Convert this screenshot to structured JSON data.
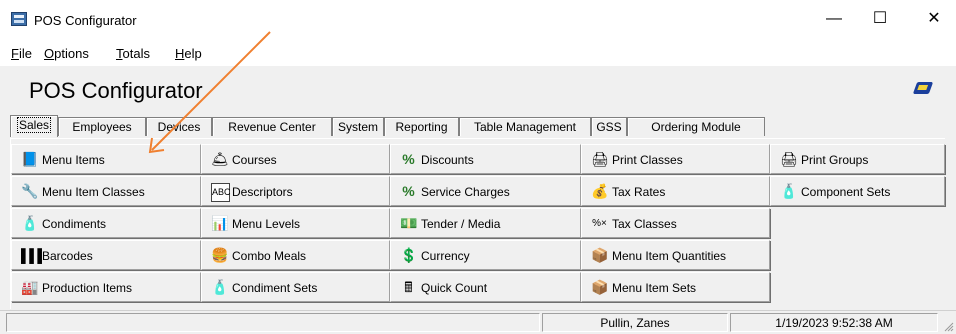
{
  "window": {
    "title": "POS Configurator",
    "minimize": "—",
    "maximize": "☐",
    "close": "✕"
  },
  "menubar": [
    {
      "label": "File",
      "accel": "F",
      "rest": "ile"
    },
    {
      "label": "Options",
      "accel": "O",
      "rest": "ptions"
    },
    {
      "label": "Totals",
      "accel": "T",
      "rest": "otals"
    },
    {
      "label": "Help",
      "accel": "H",
      "rest": "elp"
    }
  ],
  "header": {
    "title": "POS Configurator"
  },
  "tabs": [
    {
      "label": "Sales",
      "active": true
    },
    {
      "label": "Employees"
    },
    {
      "label": "Devices"
    },
    {
      "label": "Revenue Center"
    },
    {
      "label": "System"
    },
    {
      "label": "Reporting"
    },
    {
      "label": "Table Management"
    },
    {
      "label": "GSS"
    },
    {
      "label": "Ordering Module"
    }
  ],
  "grid": {
    "col1": [
      "Menu Items",
      "Menu Item Classes",
      "Condiments",
      "Barcodes",
      "Production Items"
    ],
    "col2": [
      "Courses",
      "Descriptors",
      "Menu Levels",
      "Combo Meals",
      "Condiment Sets"
    ],
    "col3": [
      "Discounts",
      "Service Charges",
      "Tender / Media",
      "Currency",
      "Quick Count"
    ],
    "col4": [
      "Print Classes",
      "Tax Rates",
      "Tax Classes",
      "Menu Item Quantities",
      "Menu Item Sets"
    ],
    "col5": [
      "Print Groups",
      "Component Sets"
    ]
  },
  "icons": {
    "col1": [
      "book-icon",
      "lamp-icon",
      "bottles-icon",
      "barcode-icon",
      "production-icon"
    ],
    "col2": [
      "bell-icon",
      "abc-card-icon",
      "levels-icon",
      "combo-icon",
      "bottles-icon"
    ],
    "col3": [
      "percent-icon",
      "percent-icon",
      "cash-icon",
      "coins-icon",
      "calculator-icon"
    ],
    "col4": [
      "printer-icon",
      "money-bag-icon",
      "percent-x-icon",
      "package-icon",
      "package-icon"
    ],
    "col5": [
      "printer-icon",
      "bottles-icon"
    ]
  },
  "status": {
    "user": "Pullin, Zanes",
    "datetime": "1/19/2023 9:52:38 AM"
  },
  "colors": {
    "annotation_arrow": "#f08030"
  }
}
